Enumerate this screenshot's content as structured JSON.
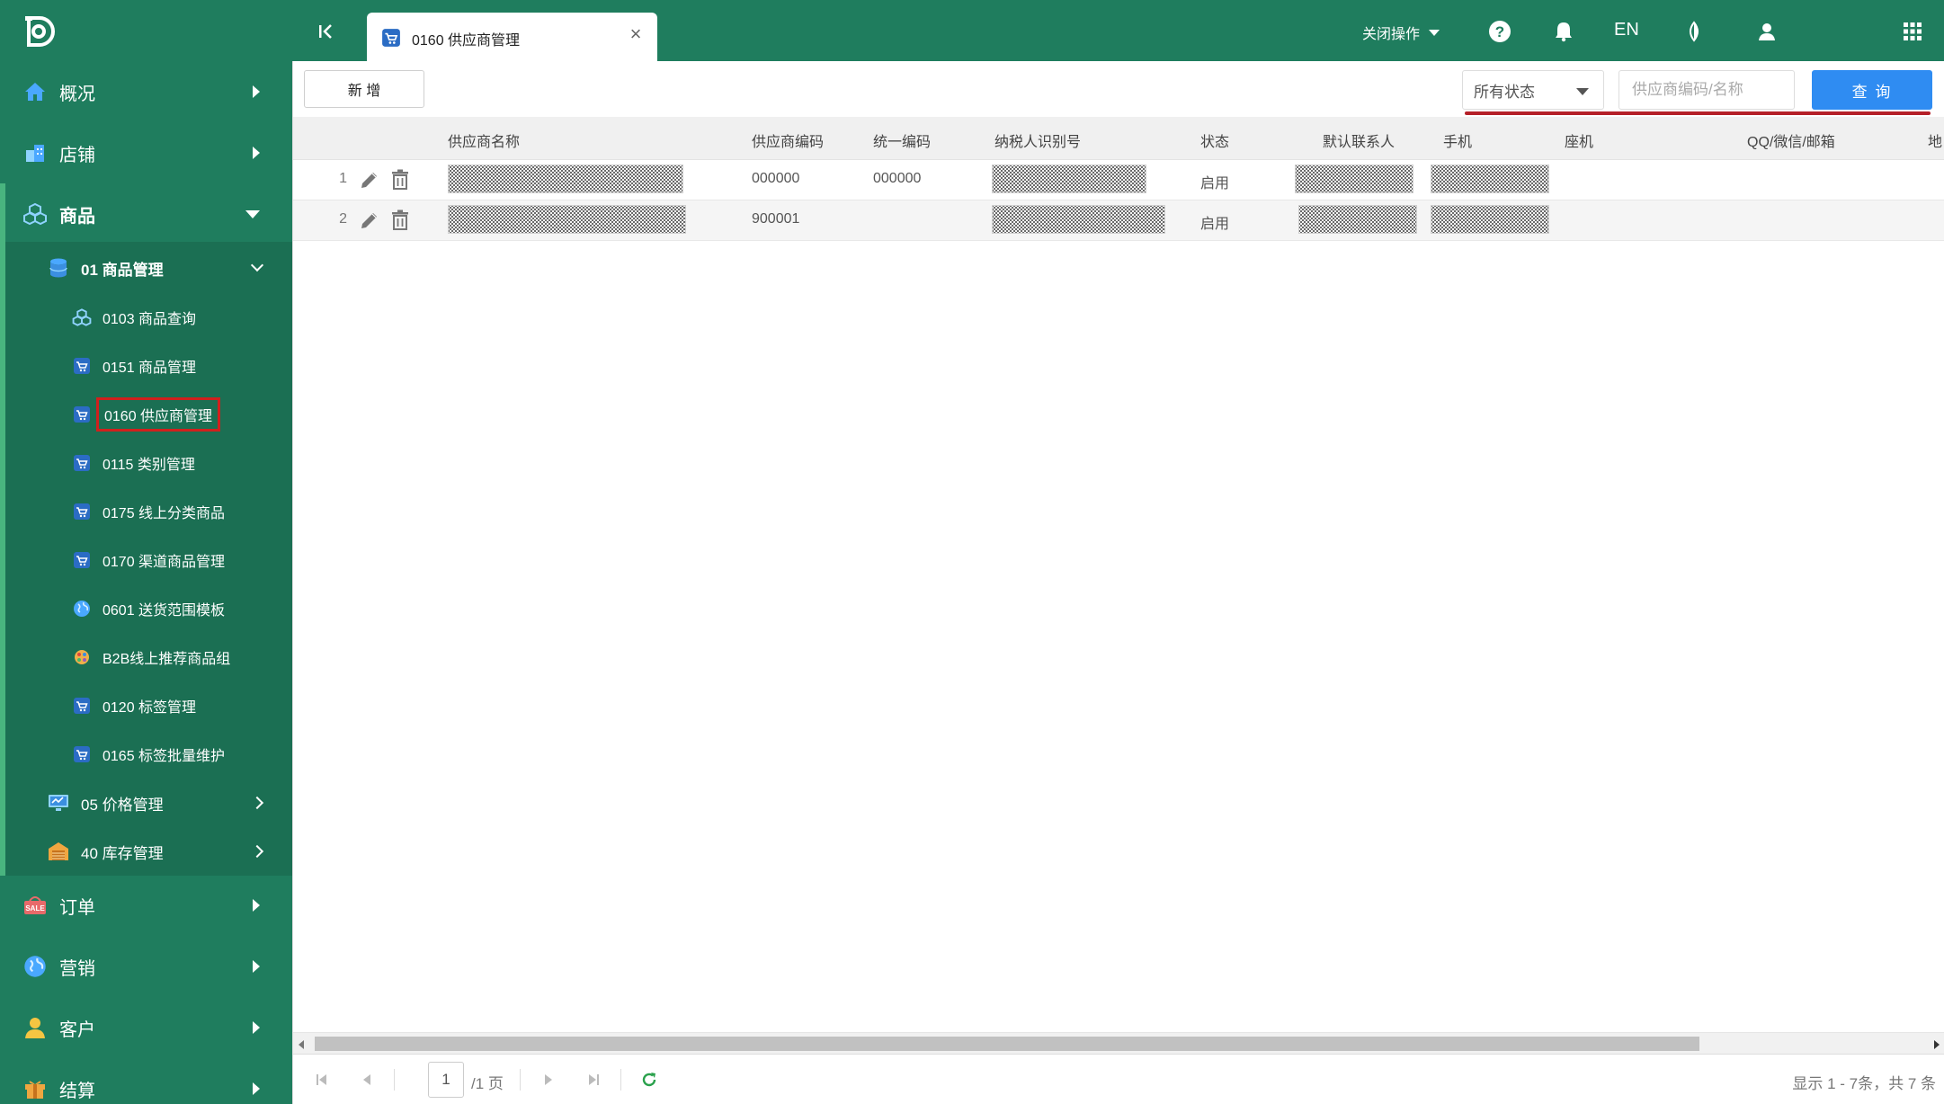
{
  "colors": {
    "sidebar": "#1f7d5e",
    "accent_blue": "#2f8cf2",
    "highlight_red": "#d0201d"
  },
  "sidebar": {
    "top_items": [
      {
        "label": "概况",
        "icon": "home-icon"
      },
      {
        "label": "店铺",
        "icon": "store-icon"
      },
      {
        "label": "商品",
        "icon": "product-icon"
      },
      {
        "label": "订单",
        "icon": "sale-tag-icon"
      },
      {
        "label": "营销",
        "icon": "globe-icon"
      },
      {
        "label": "客户",
        "icon": "user-icon"
      },
      {
        "label": "结算",
        "icon": "gift-icon"
      }
    ],
    "sub_groups": [
      {
        "label": "01 商品管理",
        "icon": "database-icon"
      },
      {
        "label": "05 价格管理",
        "icon": "monitor-icon"
      },
      {
        "label": "40 库存管理",
        "icon": "warehouse-icon"
      }
    ],
    "leaves": [
      {
        "label": "0103 商品查询",
        "icon": "cubes-icon"
      },
      {
        "label": "0151 商品管理",
        "icon": "cart-icon"
      },
      {
        "label": "0160 供应商管理",
        "icon": "cart-icon"
      },
      {
        "label": "0115 类别管理",
        "icon": "cart-icon"
      },
      {
        "label": "0175 线上分类商品",
        "icon": "cart-icon"
      },
      {
        "label": "0170 渠道商品管理",
        "icon": "cart-icon"
      },
      {
        "label": "0601 送货范围模板",
        "icon": "globe-icon"
      },
      {
        "label": "B2B线上推荐商品组",
        "icon": "palette-icon"
      },
      {
        "label": "0120 标签管理",
        "icon": "cart-icon"
      },
      {
        "label": "0165 标签批量维护",
        "icon": "cart-icon"
      }
    ]
  },
  "topbar": {
    "tab_label": "0160 供应商管理",
    "close_ops": "关闭操作",
    "lang": "EN"
  },
  "toolbar": {
    "new_label": "新 增",
    "status_value": "所有状态",
    "search_placeholder": "供应商编码/名称",
    "query_label": "查 询"
  },
  "table": {
    "columns": [
      "供应商名称",
      "供应商编码",
      "统一编码",
      "纳税人识别号",
      "状态",
      "默认联系人",
      "手机",
      "座机",
      "QQ/微信/邮箱",
      "地"
    ],
    "rows": [
      {
        "num": "1",
        "code": "000000",
        "unified": "000000",
        "status": "启用"
      },
      {
        "num": "2",
        "code": "900001",
        "unified": "",
        "status": "启用"
      }
    ]
  },
  "pager": {
    "page": "1",
    "total_pages": "/1 页",
    "info": "显示 1 - 7条，共 7 条"
  }
}
